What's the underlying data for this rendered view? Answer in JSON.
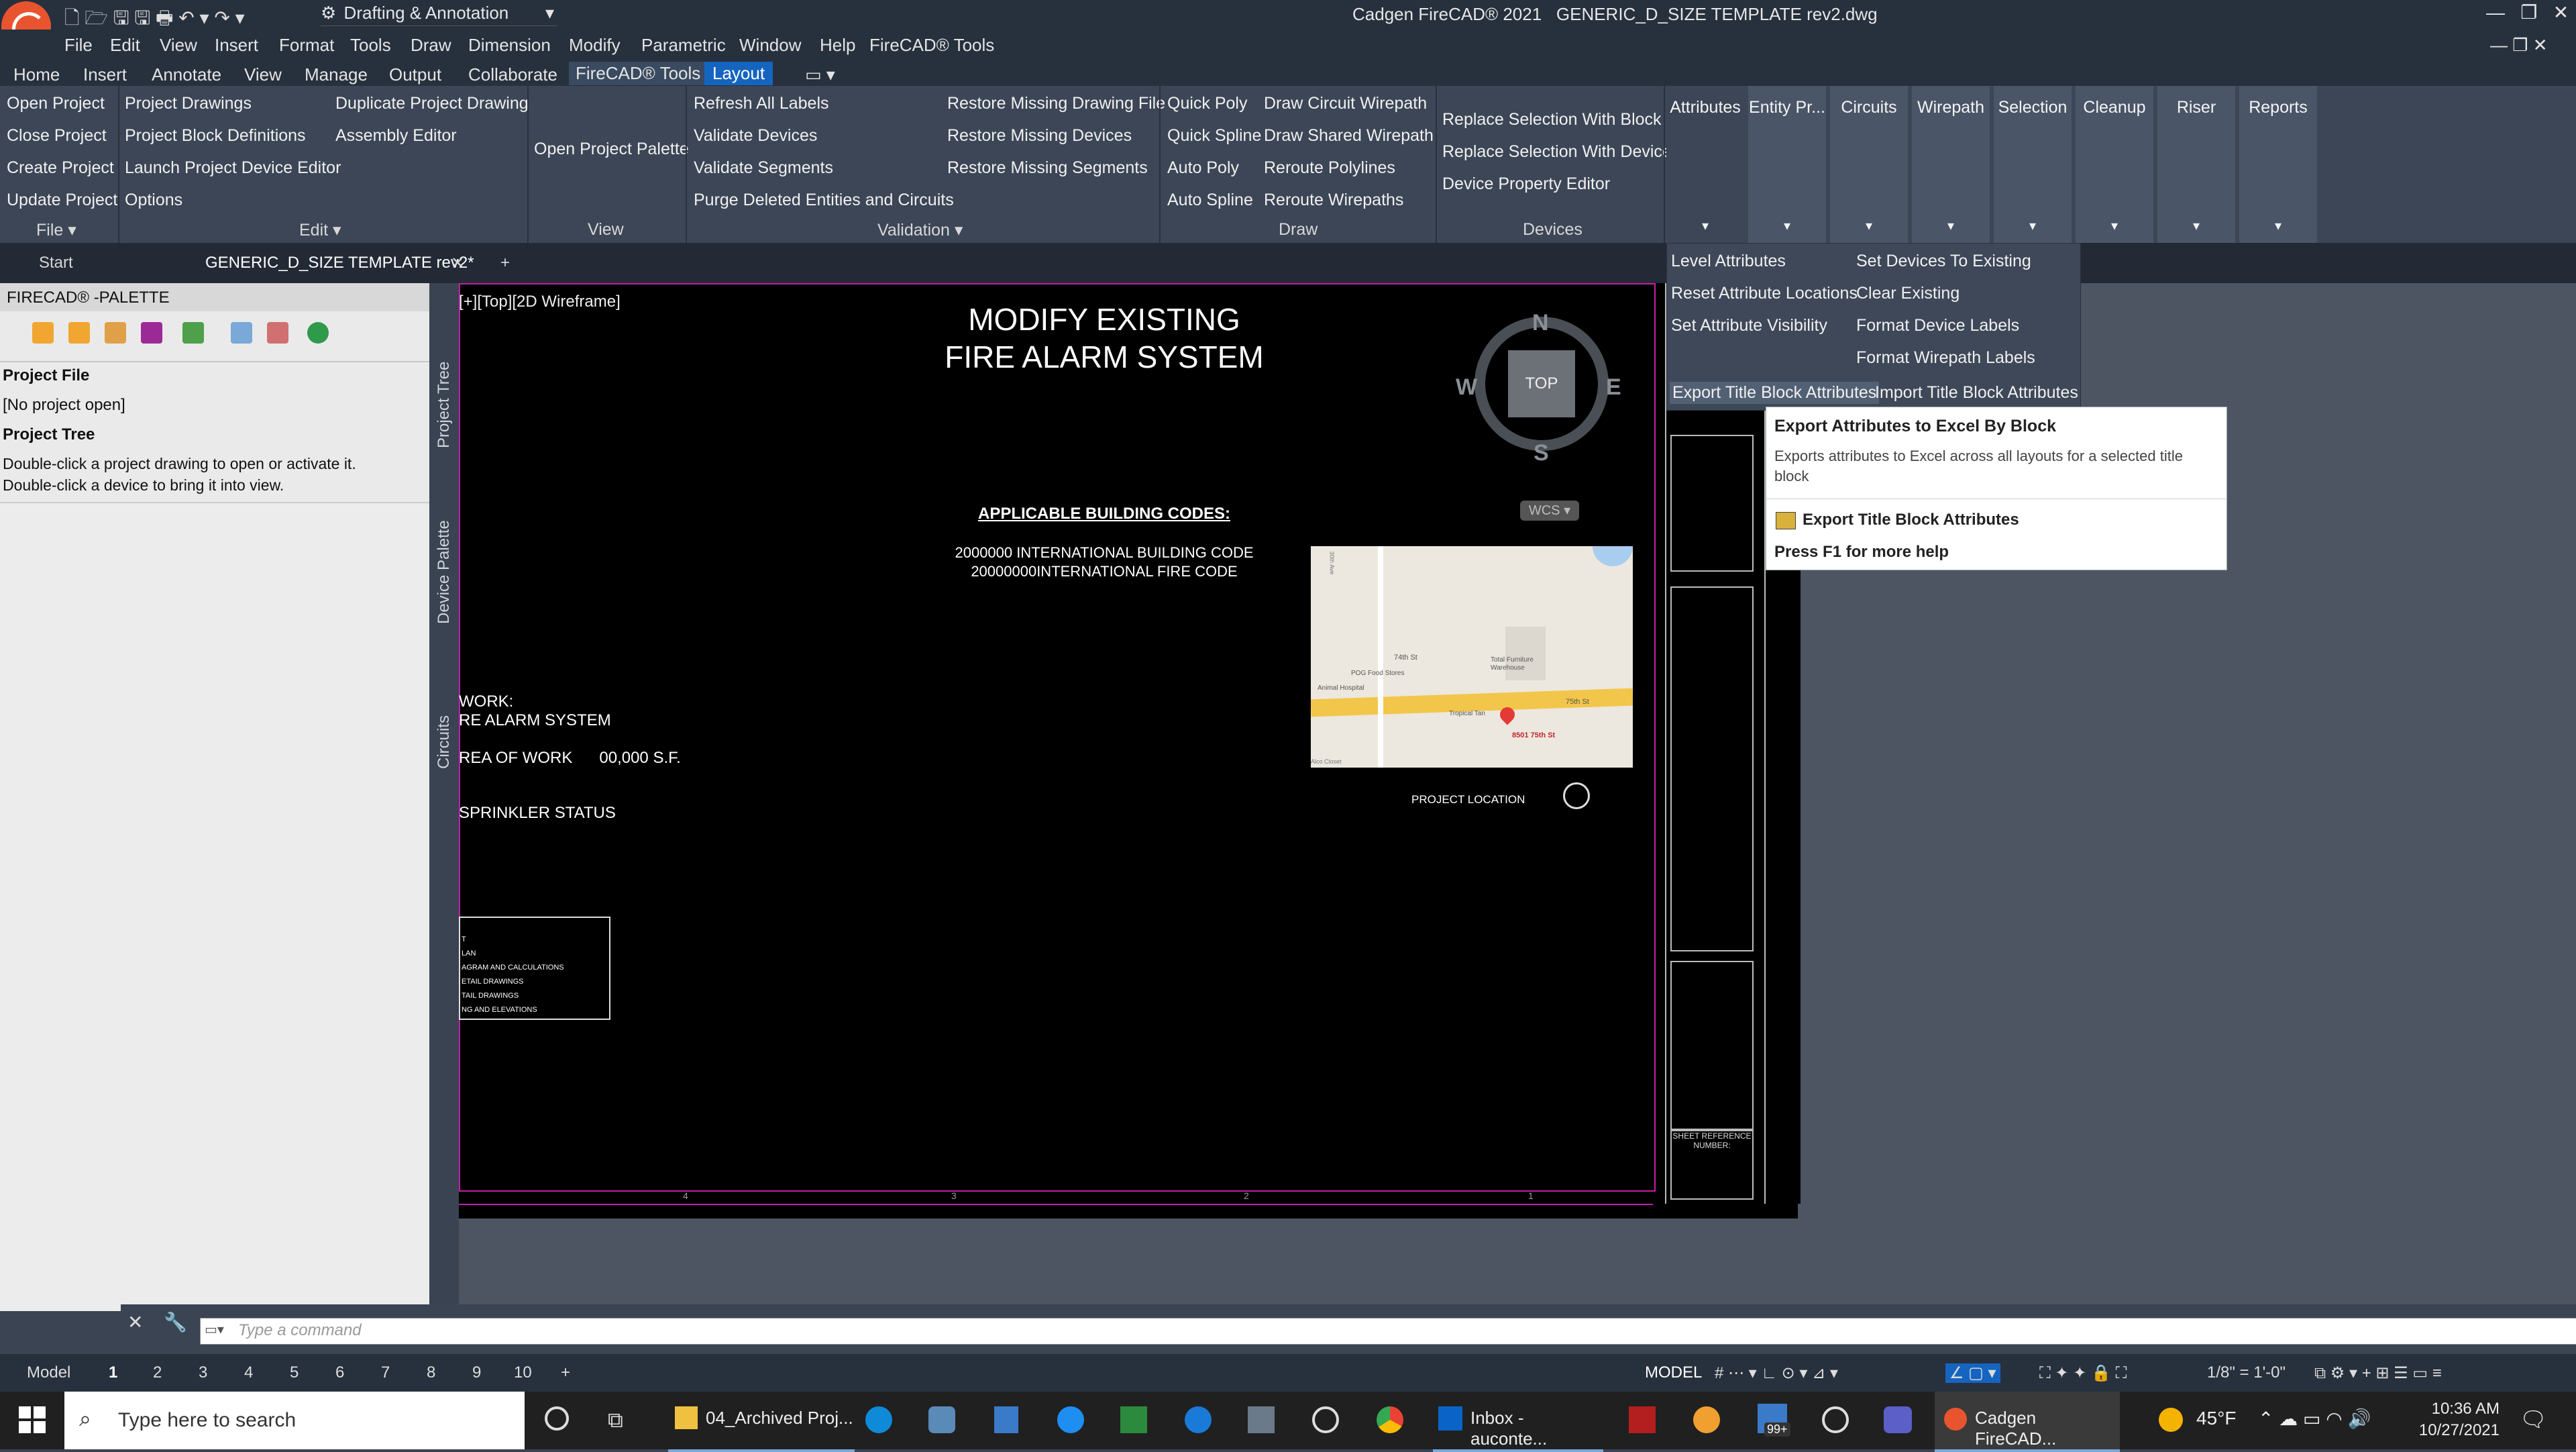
{
  "app": {
    "title": "Cadgen FireCAD® 2021",
    "file": "GENERIC_D_SIZE TEMPLATE rev2.dwg",
    "workspace": "Drafting & Annotation"
  },
  "menus": [
    "File",
    "Edit",
    "View",
    "Insert",
    "Format",
    "Tools",
    "Draw",
    "Dimension",
    "Modify",
    "Parametric",
    "Window",
    "Help",
    "FireCAD® Tools"
  ],
  "ribbon_tabs": [
    "Home",
    "Insert",
    "Annotate",
    "View",
    "Manage",
    "Output",
    "Collaborate",
    "FireCAD® Tools",
    "Layout"
  ],
  "ribbon": {
    "file": {
      "items": [
        "Open Project",
        "Close Project",
        "Create Project",
        "Update Project"
      ],
      "label": "File ▾"
    },
    "edit": {
      "col1": [
        "Project Drawings",
        "Project Block Definitions",
        "Launch Project Device Editor",
        "Options"
      ],
      "col2": [
        "Duplicate Project Drawing",
        "Assembly Editor"
      ],
      "label": "Edit ▾"
    },
    "view": {
      "items": [
        "Open Project Palette"
      ],
      "label": "View"
    },
    "validation": {
      "col1": [
        "Refresh All Labels",
        "Validate Devices",
        "Validate Segments",
        "Purge Deleted Entities and Circuits"
      ],
      "col2": [
        "Restore Missing Drawing File",
        "Restore Missing Devices",
        "Restore Missing Segments"
      ],
      "label": "Validation ▾"
    },
    "draw": {
      "col1": [
        "Quick Poly",
        "Quick Spline",
        "Auto Poly",
        "Auto Spline"
      ],
      "col2": [
        "Draw Circuit Wirepath",
        "Draw Shared  Wirepath",
        "Reroute Polylines",
        "Reroute Wirepaths"
      ],
      "label": "Draw"
    },
    "devices": {
      "items": [
        "Replace Selection With Block",
        "Replace Selection With Device",
        "Device Property Editor"
      ],
      "label": "Devices"
    },
    "big_buttons": [
      "Attributes",
      "Entity Pr...",
      "Circuits",
      "Wirepath",
      "Selection",
      "Cleanup",
      "Riser",
      "Reports"
    ]
  },
  "doc_tabs": {
    "start": "Start",
    "active": "GENERIC_D_SIZE TEMPLATE rev2*",
    "close": "✕",
    "add": "+"
  },
  "palette": {
    "title": "FIRECAD® -PALETTE",
    "project_file_label": "Project File",
    "project_file_value": "[No project open]",
    "project_tree_label": "Project Tree",
    "help1": "Double-click a project drawing to open or activate it.",
    "help2": "Double-click a device to bring it into view.",
    "side_tabs": [
      "Project Tree",
      "Device Palette",
      "Circuits"
    ]
  },
  "viewport": {
    "label": "[+][Top][2D Wireframe]"
  },
  "sheet": {
    "title1": "MODIFY EXISTING",
    "title2": "FIRE ALARM SYSTEM",
    "codes_heading": "APPLICABLE BUILDING CODES:",
    "code1": "2000000 INTERNATIONAL BUILDING CODE",
    "code2": "20000000INTERNATIONAL FIRE CODE",
    "work": "WORK:",
    "fas": "RE ALARM SYSTEM",
    "area": "REA OF WORK",
    "area_value": "00,000 S.F.",
    "sprinkler": "SPRINKLER STATUS",
    "project_location": "PROJECT LOCATION",
    "sheet_ref": "SHEET REFERENCE NUMBER:",
    "index": [
      "T",
      "LAN",
      "AGRAM AND CALCULATIONS",
      "ETAIL DRAWINGS",
      "TAIL DRAWINGS",
      "NG AND ELEVATIONS"
    ],
    "ruler": [
      "4",
      "3",
      "2",
      "1"
    ]
  },
  "viewcube": {
    "n": "N",
    "s": "S",
    "e": "E",
    "w": "W",
    "top": "TOP",
    "wcs": "WCS ▾"
  },
  "map": {
    "labels": [
      "74th St",
      "POG Food Stores",
      "Total Furniture Warehouse",
      "Animal Hospital",
      "Tropical Tan",
      "75th St",
      "8501 75th St",
      "30th Ave",
      "Alco Closet"
    ]
  },
  "dropdown": {
    "col1": [
      "Level Attributes",
      "Reset Attribute Locations",
      "Set Attribute Visibility"
    ],
    "col2": [
      "Set Devices To Existing",
      "Clear Existing",
      "Format Device Labels",
      "Format Wirepath Labels"
    ],
    "export": "Export Title Block Attributes",
    "import": "Import Title Block Attributes"
  },
  "tooltip": {
    "title": "Export Attributes to Excel By Block",
    "desc": "Exports attributes to Excel across all layouts for a selected title block",
    "command": "Export Title Block Attributes",
    "help": "Press F1 for more help"
  },
  "command": {
    "placeholder": "Type  a  command"
  },
  "layout_tabs": [
    "Model",
    "1",
    "2",
    "3",
    "4",
    "5",
    "6",
    "7",
    "8",
    "9",
    "10",
    "+"
  ],
  "status": {
    "mode": "MODEL",
    "scale": "1/8\" = 1'-0\""
  },
  "taskbar": {
    "search": "Type here to search",
    "apps": [
      "04_Archived Proj...",
      "Inbox - auconte...",
      "Cadgen FireCAD..."
    ],
    "weather": "45°F",
    "time": "10:36 AM",
    "date": "10/27/2021",
    "badge": "99+"
  },
  "colors": {
    "accent": "#1565c0",
    "magenta_border": "#c21fa6",
    "ribbon": "#3c4656"
  }
}
